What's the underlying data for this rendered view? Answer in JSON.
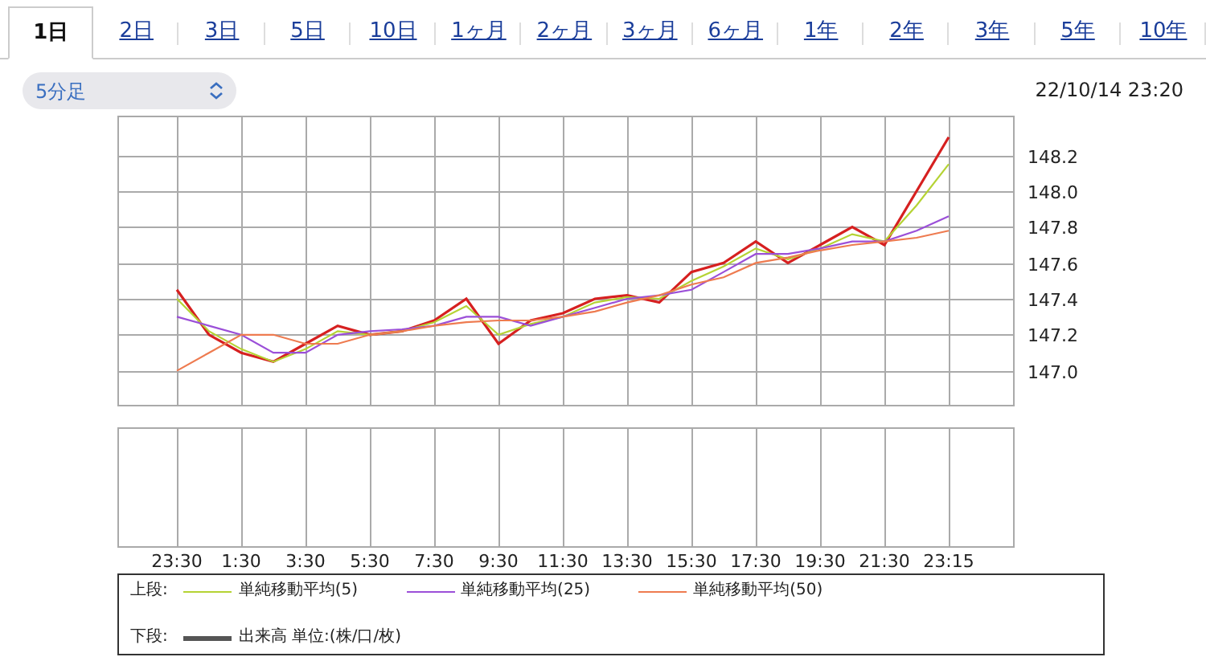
{
  "tabs": [
    {
      "label": "1日",
      "selected": true
    },
    {
      "label": "2日",
      "selected": false
    },
    {
      "label": "3日",
      "selected": false
    },
    {
      "label": "5日",
      "selected": false
    },
    {
      "label": "10日",
      "selected": false
    },
    {
      "label": "1ヶ月",
      "selected": false
    },
    {
      "label": "2ヶ月",
      "selected": false
    },
    {
      "label": "3ヶ月",
      "selected": false
    },
    {
      "label": "6ヶ月",
      "selected": false
    },
    {
      "label": "1年",
      "selected": false
    },
    {
      "label": "2年",
      "selected": false
    },
    {
      "label": "3年",
      "selected": false
    },
    {
      "label": "5年",
      "selected": false
    },
    {
      "label": "10年",
      "selected": false
    }
  ],
  "interval_select": {
    "value": "5分足"
  },
  "timestamp": "22/10/14 23:20",
  "price_chart": {
    "chart_data": {
      "type": "line",
      "categories": [
        null,
        null,
        null,
        null,
        null,
        null,
        null,
        null,
        null,
        null,
        null,
        null,
        null,
        null,
        null,
        null,
        null,
        null,
        null,
        null,
        null,
        null,
        null,
        null,
        null
      ],
      "series": [
        {
          "color": "#d62020",
          "values": [
            147.45,
            147.2,
            147.1,
            147.05,
            147.15,
            147.25,
            147.2,
            147.22,
            147.28,
            147.4,
            147.15,
            147.28,
            147.32,
            147.4,
            147.42,
            147.38,
            147.55,
            147.6,
            147.72,
            147.6,
            147.7,
            147.8,
            147.7,
            148.0,
            148.3
          ]
        },
        {
          "name": "単純移動平均(5)",
          "color": "#b5d334",
          "values": [
            147.4,
            147.22,
            147.12,
            147.05,
            147.12,
            147.22,
            147.2,
            147.22,
            147.27,
            147.36,
            147.2,
            147.26,
            147.3,
            147.38,
            147.41,
            147.4,
            147.5,
            147.58,
            147.68,
            147.62,
            147.68,
            147.76,
            147.72,
            147.92,
            148.15
          ]
        },
        {
          "name": "単純移動平均(25)",
          "color": "#9b4fd8",
          "values": [
            147.3,
            147.25,
            147.2,
            147.1,
            147.1,
            147.2,
            147.22,
            147.23,
            147.25,
            147.3,
            147.3,
            147.25,
            147.3,
            147.35,
            147.4,
            147.42,
            147.45,
            147.55,
            147.65,
            147.65,
            147.68,
            147.72,
            147.72,
            147.78,
            147.86
          ]
        },
        {
          "name": "単純移動平均(50)",
          "color": "#ee7b50",
          "values": [
            147.0,
            147.1,
            147.2,
            147.2,
            147.15,
            147.15,
            147.2,
            147.22,
            147.25,
            147.27,
            147.28,
            147.28,
            147.3,
            147.33,
            147.38,
            147.42,
            147.48,
            147.52,
            147.6,
            147.63,
            147.67,
            147.7,
            147.72,
            147.74,
            147.78
          ]
        }
      ],
      "ylim": [
        146.81,
        148.42
      ],
      "grid": true,
      "yticks": [
        {
          "value": 147.0,
          "label": "147.0"
        },
        {
          "value": 147.2,
          "label": "147.2"
        },
        {
          "value": 147.4,
          "label": "147.4"
        },
        {
          "value": 147.6,
          "label": "147.6"
        },
        {
          "value": 147.8,
          "label": "147.8"
        },
        {
          "value": 148.0,
          "label": "148.0"
        },
        {
          "value": 148.2,
          "label": "148.2"
        }
      ]
    }
  },
  "volume_chart": {
    "chart_data": {
      "type": "other",
      "categories": [
        "23:30",
        null,
        "1:30",
        null,
        "3:30",
        null,
        "5:30",
        null,
        "7:30",
        null,
        "9:30",
        null,
        "11:30",
        null,
        "13:30",
        null,
        "15:30",
        null,
        "17:30",
        null,
        "19:30",
        null,
        "21:30",
        null,
        "23:15"
      ],
      "series": [
        {
          "name": "出来高 単位:(株/口/枚)",
          "color": "#555555",
          "values": [
            null,
            null,
            null,
            null,
            null,
            null,
            null,
            null,
            null,
            null,
            null,
            null,
            null,
            null,
            null,
            null,
            null,
            null,
            null,
            null,
            null,
            null,
            null,
            null,
            null
          ]
        }
      ]
    }
  },
  "legend": {
    "upper_label": "上段:",
    "lower_label": "下段:"
  }
}
